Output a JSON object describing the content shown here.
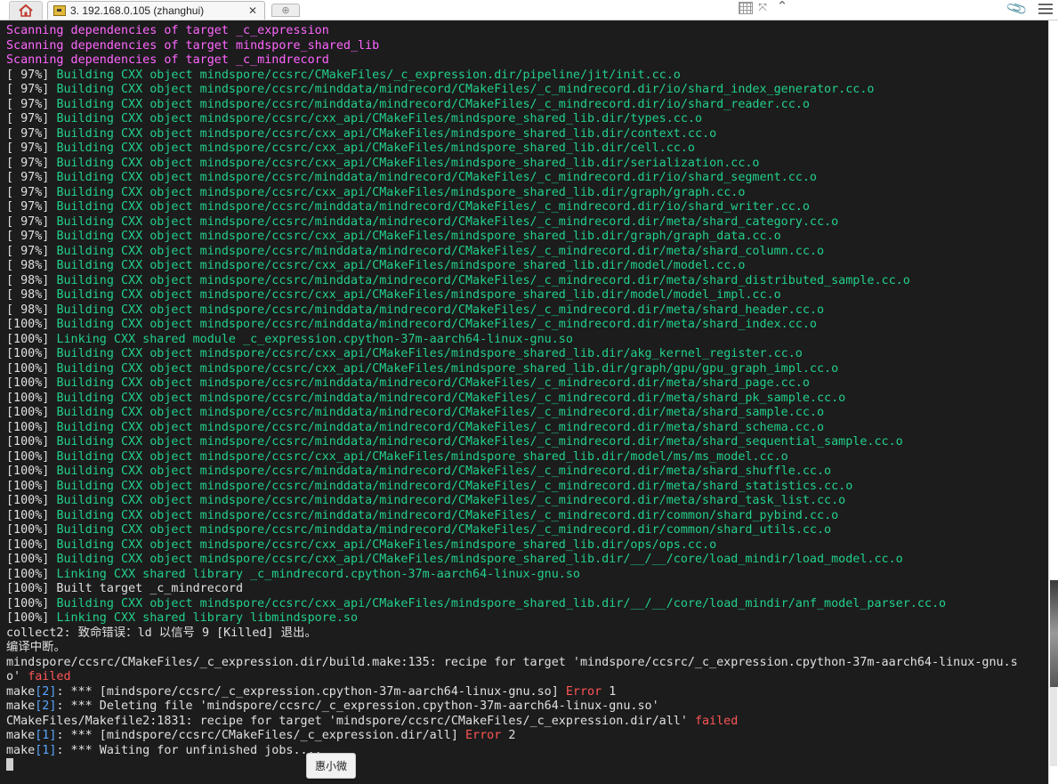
{
  "tabbar": {
    "session_title": "3. 192.168.0.105 (zhanghui)",
    "close_label": "✕",
    "new_tab_label": "⊕",
    "home_icon": "home-icon",
    "session_icon": "key-icon"
  },
  "ime": {
    "label": "惠小微"
  },
  "colors": {
    "terminal_bg": "#1c1c1c",
    "pink": "#ff66ff",
    "green": "#22d08a",
    "red": "#ff5555",
    "blue": "#58a6ff"
  },
  "terminal": {
    "lines": [
      [
        {
          "t": "Scanning dependencies of target _c_expression",
          "c": "pink"
        }
      ],
      [
        {
          "t": "Scanning dependencies of target mindspore_shared_lib",
          "c": "pink"
        }
      ],
      [
        {
          "t": "Scanning dependencies of target _c_mindrecord",
          "c": "pink"
        }
      ],
      [
        {
          "t": "[ 97%] ",
          "c": "white"
        },
        {
          "t": "Building CXX object mindspore/ccsrc/CMakeFiles/_c_expression.dir/pipeline/jit/init.cc.o",
          "c": "green"
        }
      ],
      [
        {
          "t": "[ 97%] ",
          "c": "white"
        },
        {
          "t": "Building CXX object mindspore/ccsrc/minddata/mindrecord/CMakeFiles/_c_mindrecord.dir/io/shard_index_generator.cc.o",
          "c": "green"
        }
      ],
      [
        {
          "t": "[ 97%] ",
          "c": "white"
        },
        {
          "t": "Building CXX object mindspore/ccsrc/minddata/mindrecord/CMakeFiles/_c_mindrecord.dir/io/shard_reader.cc.o",
          "c": "green"
        }
      ],
      [
        {
          "t": "[ 97%] ",
          "c": "white"
        },
        {
          "t": "Building CXX object mindspore/ccsrc/cxx_api/CMakeFiles/mindspore_shared_lib.dir/types.cc.o",
          "c": "green"
        }
      ],
      [
        {
          "t": "[ 97%] ",
          "c": "white"
        },
        {
          "t": "Building CXX object mindspore/ccsrc/cxx_api/CMakeFiles/mindspore_shared_lib.dir/context.cc.o",
          "c": "green"
        }
      ],
      [
        {
          "t": "[ 97%] ",
          "c": "white"
        },
        {
          "t": "Building CXX object mindspore/ccsrc/cxx_api/CMakeFiles/mindspore_shared_lib.dir/cell.cc.o",
          "c": "green"
        }
      ],
      [
        {
          "t": "[ 97%] ",
          "c": "white"
        },
        {
          "t": "Building CXX object mindspore/ccsrc/cxx_api/CMakeFiles/mindspore_shared_lib.dir/serialization.cc.o",
          "c": "green"
        }
      ],
      [
        {
          "t": "[ 97%] ",
          "c": "white"
        },
        {
          "t": "Building CXX object mindspore/ccsrc/minddata/mindrecord/CMakeFiles/_c_mindrecord.dir/io/shard_segment.cc.o",
          "c": "green"
        }
      ],
      [
        {
          "t": "[ 97%] ",
          "c": "white"
        },
        {
          "t": "Building CXX object mindspore/ccsrc/cxx_api/CMakeFiles/mindspore_shared_lib.dir/graph/graph.cc.o",
          "c": "green"
        }
      ],
      [
        {
          "t": "[ 97%] ",
          "c": "white"
        },
        {
          "t": "Building CXX object mindspore/ccsrc/minddata/mindrecord/CMakeFiles/_c_mindrecord.dir/io/shard_writer.cc.o",
          "c": "green"
        }
      ],
      [
        {
          "t": "[ 97%] ",
          "c": "white"
        },
        {
          "t": "Building CXX object mindspore/ccsrc/minddata/mindrecord/CMakeFiles/_c_mindrecord.dir/meta/shard_category.cc.o",
          "c": "green"
        }
      ],
      [
        {
          "t": "[ 97%] ",
          "c": "white"
        },
        {
          "t": "Building CXX object mindspore/ccsrc/cxx_api/CMakeFiles/mindspore_shared_lib.dir/graph/graph_data.cc.o",
          "c": "green"
        }
      ],
      [
        {
          "t": "[ 97%] ",
          "c": "white"
        },
        {
          "t": "Building CXX object mindspore/ccsrc/minddata/mindrecord/CMakeFiles/_c_mindrecord.dir/meta/shard_column.cc.o",
          "c": "green"
        }
      ],
      [
        {
          "t": "[ 98%] ",
          "c": "white"
        },
        {
          "t": "Building CXX object mindspore/ccsrc/cxx_api/CMakeFiles/mindspore_shared_lib.dir/model/model.cc.o",
          "c": "green"
        }
      ],
      [
        {
          "t": "[ 98%] ",
          "c": "white"
        },
        {
          "t": "Building CXX object mindspore/ccsrc/minddata/mindrecord/CMakeFiles/_c_mindrecord.dir/meta/shard_distributed_sample.cc.o",
          "c": "green"
        }
      ],
      [
        {
          "t": "[ 98%] ",
          "c": "white"
        },
        {
          "t": "Building CXX object mindspore/ccsrc/cxx_api/CMakeFiles/mindspore_shared_lib.dir/model/model_impl.cc.o",
          "c": "green"
        }
      ],
      [
        {
          "t": "[ 98%] ",
          "c": "white"
        },
        {
          "t": "Building CXX object mindspore/ccsrc/minddata/mindrecord/CMakeFiles/_c_mindrecord.dir/meta/shard_header.cc.o",
          "c": "green"
        }
      ],
      [
        {
          "t": "[100%] ",
          "c": "white"
        },
        {
          "t": "Building CXX object mindspore/ccsrc/minddata/mindrecord/CMakeFiles/_c_mindrecord.dir/meta/shard_index.cc.o",
          "c": "green"
        }
      ],
      [
        {
          "t": "[100%] ",
          "c": "white"
        },
        {
          "t": "Linking CXX shared module _c_expression.cpython-37m-aarch64-linux-gnu.so",
          "c": "green"
        }
      ],
      [
        {
          "t": "[100%] ",
          "c": "white"
        },
        {
          "t": "Building CXX object mindspore/ccsrc/cxx_api/CMakeFiles/mindspore_shared_lib.dir/akg_kernel_register.cc.o",
          "c": "green"
        }
      ],
      [
        {
          "t": "[100%] ",
          "c": "white"
        },
        {
          "t": "Building CXX object mindspore/ccsrc/cxx_api/CMakeFiles/mindspore_shared_lib.dir/graph/gpu/gpu_graph_impl.cc.o",
          "c": "green"
        }
      ],
      [
        {
          "t": "[100%] ",
          "c": "white"
        },
        {
          "t": "Building CXX object mindspore/ccsrc/minddata/mindrecord/CMakeFiles/_c_mindrecord.dir/meta/shard_page.cc.o",
          "c": "green"
        }
      ],
      [
        {
          "t": "[100%] ",
          "c": "white"
        },
        {
          "t": "Building CXX object mindspore/ccsrc/minddata/mindrecord/CMakeFiles/_c_mindrecord.dir/meta/shard_pk_sample.cc.o",
          "c": "green"
        }
      ],
      [
        {
          "t": "[100%] ",
          "c": "white"
        },
        {
          "t": "Building CXX object mindspore/ccsrc/minddata/mindrecord/CMakeFiles/_c_mindrecord.dir/meta/shard_sample.cc.o",
          "c": "green"
        }
      ],
      [
        {
          "t": "[100%] ",
          "c": "white"
        },
        {
          "t": "Building CXX object mindspore/ccsrc/minddata/mindrecord/CMakeFiles/_c_mindrecord.dir/meta/shard_schema.cc.o",
          "c": "green"
        }
      ],
      [
        {
          "t": "[100%] ",
          "c": "white"
        },
        {
          "t": "Building CXX object mindspore/ccsrc/minddata/mindrecord/CMakeFiles/_c_mindrecord.dir/meta/shard_sequential_sample.cc.o",
          "c": "green"
        }
      ],
      [
        {
          "t": "[100%] ",
          "c": "white"
        },
        {
          "t": "Building CXX object mindspore/ccsrc/cxx_api/CMakeFiles/mindspore_shared_lib.dir/model/ms/ms_model.cc.o",
          "c": "green"
        }
      ],
      [
        {
          "t": "[100%] ",
          "c": "white"
        },
        {
          "t": "Building CXX object mindspore/ccsrc/minddata/mindrecord/CMakeFiles/_c_mindrecord.dir/meta/shard_shuffle.cc.o",
          "c": "green"
        }
      ],
      [
        {
          "t": "[100%] ",
          "c": "white"
        },
        {
          "t": "Building CXX object mindspore/ccsrc/minddata/mindrecord/CMakeFiles/_c_mindrecord.dir/meta/shard_statistics.cc.o",
          "c": "green"
        }
      ],
      [
        {
          "t": "[100%] ",
          "c": "white"
        },
        {
          "t": "Building CXX object mindspore/ccsrc/minddata/mindrecord/CMakeFiles/_c_mindrecord.dir/meta/shard_task_list.cc.o",
          "c": "green"
        }
      ],
      [
        {
          "t": "[100%] ",
          "c": "white"
        },
        {
          "t": "Building CXX object mindspore/ccsrc/minddata/mindrecord/CMakeFiles/_c_mindrecord.dir/common/shard_pybind.cc.o",
          "c": "green"
        }
      ],
      [
        {
          "t": "[100%] ",
          "c": "white"
        },
        {
          "t": "Building CXX object mindspore/ccsrc/minddata/mindrecord/CMakeFiles/_c_mindrecord.dir/common/shard_utils.cc.o",
          "c": "green"
        }
      ],
      [
        {
          "t": "[100%] ",
          "c": "white"
        },
        {
          "t": "Building CXX object mindspore/ccsrc/cxx_api/CMakeFiles/mindspore_shared_lib.dir/ops/ops.cc.o",
          "c": "green"
        }
      ],
      [
        {
          "t": "[100%] ",
          "c": "white"
        },
        {
          "t": "Building CXX object mindspore/ccsrc/cxx_api/CMakeFiles/mindspore_shared_lib.dir/__/__/core/load_mindir/load_model.cc.o",
          "c": "green"
        }
      ],
      [
        {
          "t": "[100%] ",
          "c": "white"
        },
        {
          "t": "Linking CXX shared library _c_mindrecord.cpython-37m-aarch64-linux-gnu.so",
          "c": "green"
        }
      ],
      [
        {
          "t": "[100%] Built target _c_mindrecord",
          "c": "white"
        }
      ],
      [
        {
          "t": "[100%] ",
          "c": "white"
        },
        {
          "t": "Building CXX object mindspore/ccsrc/cxx_api/CMakeFiles/mindspore_shared_lib.dir/__/__/core/load_mindir/anf_model_parser.cc.o",
          "c": "green"
        }
      ],
      [
        {
          "t": "[100%] ",
          "c": "white"
        },
        {
          "t": "Linking CXX shared library libmindspore.so",
          "c": "green"
        }
      ],
      [
        {
          "t": "collect2: 致命错误：ld 以信号 9 [Killed] 退出。",
          "c": "white"
        }
      ],
      [
        {
          "t": "编译中断。",
          "c": "white"
        }
      ],
      [
        {
          "t": "mindspore/ccsrc/CMakeFiles/_c_expression.dir/build.make:135: recipe for target 'mindspore/ccsrc/_c_expression.cpython-37m-aarch64-linux-gnu.s",
          "c": "white"
        }
      ],
      [
        {
          "t": "o' ",
          "c": "white"
        },
        {
          "t": "failed",
          "c": "red"
        }
      ],
      [
        {
          "t": "make",
          "c": "white"
        },
        {
          "t": "[2]",
          "c": "blue"
        },
        {
          "t": ": *** [mindspore/ccsrc/_c_expression.cpython-37m-aarch64-linux-gnu.so] ",
          "c": "white"
        },
        {
          "t": "Error",
          "c": "red"
        },
        {
          "t": " 1",
          "c": "white"
        }
      ],
      [
        {
          "t": "make",
          "c": "white"
        },
        {
          "t": "[2]",
          "c": "blue"
        },
        {
          "t": ": *** Deleting file 'mindspore/ccsrc/_c_expression.cpython-37m-aarch64-linux-gnu.so'",
          "c": "white"
        }
      ],
      [
        {
          "t": "CMakeFiles/Makefile2:1831: recipe for target 'mindspore/ccsrc/CMakeFiles/_c_expression.dir/all' ",
          "c": "white"
        },
        {
          "t": "failed",
          "c": "red"
        }
      ],
      [
        {
          "t": "make",
          "c": "white"
        },
        {
          "t": "[1]",
          "c": "blue"
        },
        {
          "t": ": *** [mindspore/ccsrc/CMakeFiles/_c_expression.dir/all] ",
          "c": "white"
        },
        {
          "t": "Error",
          "c": "red"
        },
        {
          "t": " 2",
          "c": "white"
        }
      ],
      [
        {
          "t": "make",
          "c": "white"
        },
        {
          "t": "[1]",
          "c": "blue"
        },
        {
          "t": ": *** Waiting for unfinished jobs....",
          "c": "white"
        }
      ]
    ]
  }
}
